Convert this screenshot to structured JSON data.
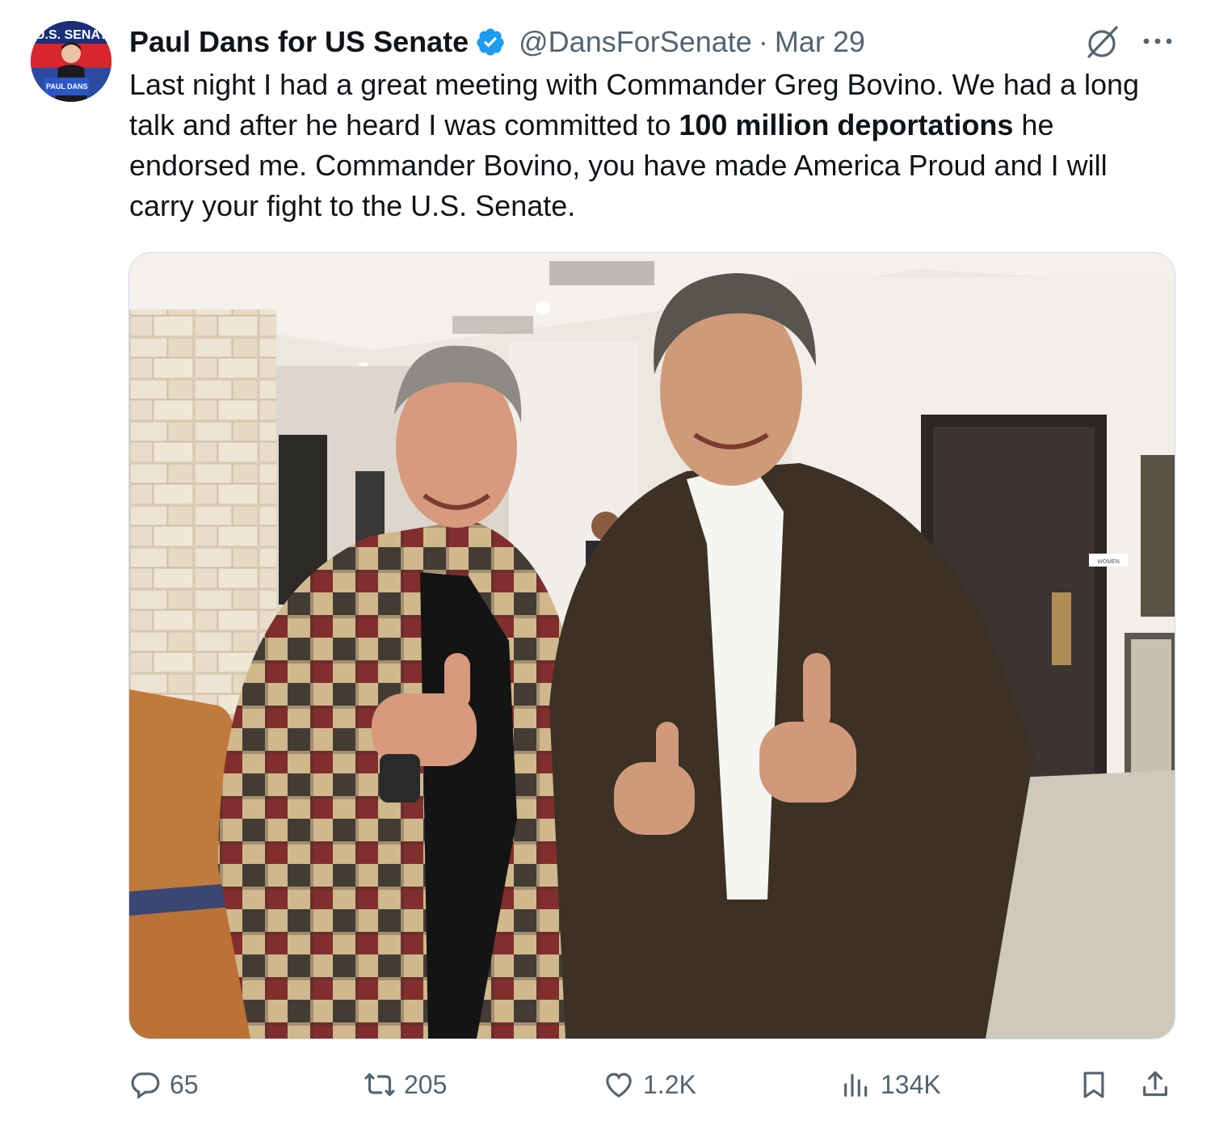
{
  "author": {
    "name": "Paul Dans for US Senate",
    "handle": "@DansForSenate",
    "separator": "·",
    "date": "Mar 29",
    "verified": true,
    "avatar_sign_top": "U.S. SENAT",
    "avatar_sign_bottom": "PAUL DANS"
  },
  "tweet": {
    "text_before": "Last night I had a great meeting with Commander Greg Bovino. We had a long talk and after he heard I was committed to ",
    "text_bold": "100 million deportations",
    "text_after": " he endorsed me. Commander Bovino, you have made America Proud and I will carry your fight to the U.S. Senate."
  },
  "media": {
    "sign_text": "WOMEN"
  },
  "actions": {
    "replies": "65",
    "reposts": "205",
    "likes": "1.2K",
    "views": "134K"
  },
  "colors": {
    "verified_blue": "#1d9bf0",
    "muted_text": "#536471",
    "primary_text": "#0f1419"
  },
  "icons": [
    "grok-icon",
    "more-icon",
    "reply-icon",
    "repost-icon",
    "like-icon",
    "views-icon",
    "bookmark-icon",
    "share-icon",
    "verified-badge-icon"
  ]
}
